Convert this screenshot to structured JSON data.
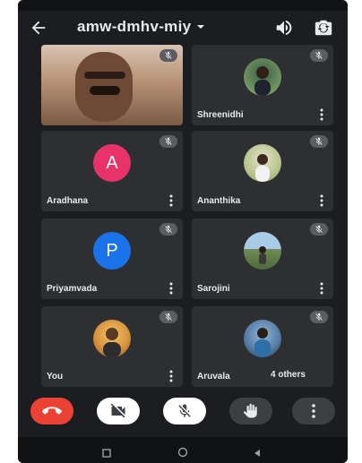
{
  "app": {
    "title": "amw-dmhv-miy"
  },
  "icons": {
    "back": "arrow-back-icon",
    "dropdown": "chevron-down-icon",
    "speaker": "speaker-icon",
    "camera_flip": "camera-flip-icon",
    "muted": "mic-off-icon",
    "more": "more-vert-icon",
    "end_call": "call-end-icon",
    "video_off": "videocam-off-icon",
    "mic_off": "mic-off-icon",
    "hand": "raise-hand-icon",
    "more_options": "more-vert-icon"
  },
  "participants": [
    {
      "name": "",
      "avatar": "self-video"
    },
    {
      "name": "Shreenidhi",
      "avatar": "photo"
    },
    {
      "name": "Aradhana",
      "avatar": "A",
      "avatar_color": "#e8336a"
    },
    {
      "name": "Ananthika",
      "avatar": "photo"
    },
    {
      "name": "Priyamvada",
      "avatar": "P",
      "avatar_color": "#1a73e8"
    },
    {
      "name": "Sarojini",
      "avatar": "photo"
    },
    {
      "name": "You",
      "avatar": "photo"
    },
    {
      "name": "Aruvala",
      "avatar": "photo",
      "extra": "4 others"
    }
  ],
  "colors": {
    "end_call": "#ea4335",
    "toggle_on": "#ffffff",
    "toggle_muted": "#3c4043",
    "background": "#1b1d20",
    "tile": "#2d2f33"
  }
}
